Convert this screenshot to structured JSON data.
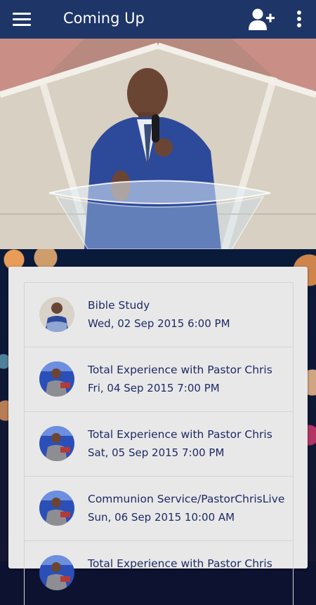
{
  "app": {
    "title": "Coming Up",
    "accent_color": "#1e3567",
    "icons": [
      "menu-icon",
      "add-user-icon",
      "more-vert-icon"
    ]
  },
  "events": [
    {
      "title": "Bible Study",
      "date": "Wed, 02 Sep 2015 6:00 PM"
    },
    {
      "title": "Total Experience with Pastor Chris",
      "date": "Fri, 04 Sep 2015 7:00 PM"
    },
    {
      "title": "Total Experience with Pastor Chris",
      "date": "Sat, 05 Sep 2015 7:00 PM"
    },
    {
      "title": "Communion Service/PastorChrisLive",
      "date": "Sun, 06 Sep 2015 10:00 AM"
    },
    {
      "title": "Total Experience with Pastor Chris",
      "date": ""
    }
  ]
}
